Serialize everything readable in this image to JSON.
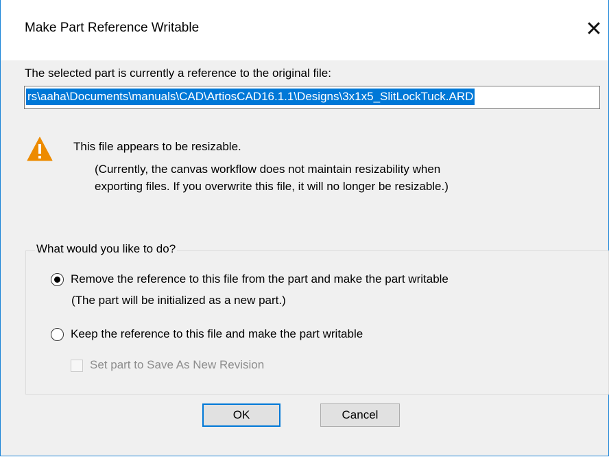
{
  "window": {
    "title": "Make Part Reference Writable",
    "close_glyph": "✕",
    "accent_color": "#0078d7"
  },
  "intro_text": "The selected part is currently a reference to the original file:",
  "file_path": "rs\\aaha\\Documents\\manuals\\CAD\\ArtiosCAD16.1.1\\Designs\\3x1x5_SlitLockTuck.ARD",
  "warning": {
    "icon": "warning-icon",
    "title": "This file appears to be resizable.",
    "detail_line1": "(Currently, the canvas workflow does not maintain resizability when",
    "detail_line2": "exporting files. If you overwrite this file, it will no longer be resizable.)"
  },
  "options": {
    "legend": "What would you like to do?",
    "remove_label": "Remove the reference to this file from the part and make the part writable",
    "remove_note": "(The part will be initialized as a new part.)",
    "keep_label": "Keep the reference to this file and make the part writable",
    "selected": "remove",
    "revision_label": "Set part to Save As New Revision",
    "revision_enabled": false,
    "revision_checked": false
  },
  "buttons": {
    "ok": "OK",
    "cancel": "Cancel"
  }
}
